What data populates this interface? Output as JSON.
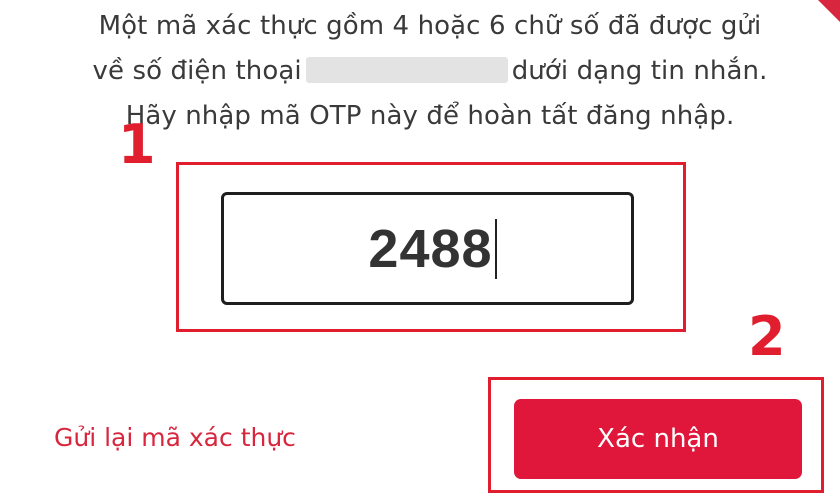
{
  "instructions": {
    "line1": "Một mã xác thực gồm 4 hoặc 6 chữ số đã được gửi",
    "line2_before": "về số điện thoại",
    "line2_after": "dưới dạng tin nhắn.",
    "line3": "Hãy nhập mã OTP này để hoàn tất đăng nhập."
  },
  "annotations": {
    "step1": "1",
    "step2": "2",
    "highlight_color": "#e01e2d"
  },
  "otp": {
    "value": "2488"
  },
  "actions": {
    "resend_label": "Gửi lại mã xác thực",
    "confirm_label": "Xác nhận"
  },
  "colors": {
    "brand_red": "#e0173a",
    "link_red": "#d7263d",
    "text": "#3a3a3a"
  }
}
